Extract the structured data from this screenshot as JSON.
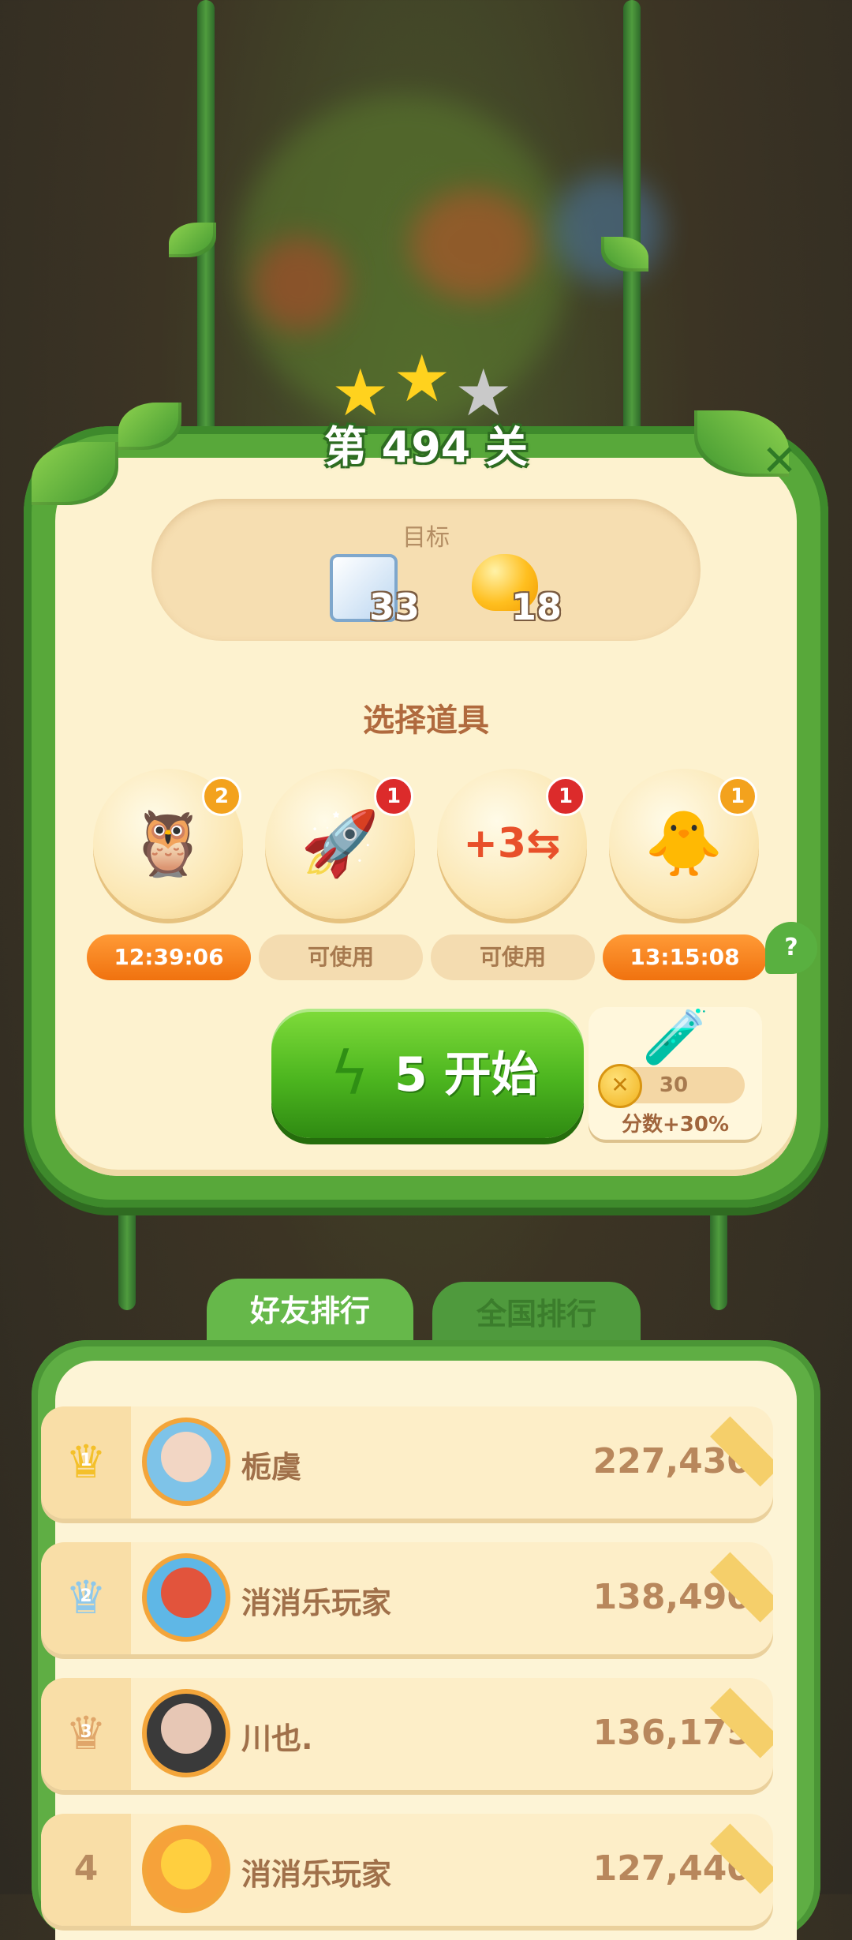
{
  "level": {
    "title": "第 494 关",
    "stars": [
      "gold",
      "gold",
      "gray"
    ]
  },
  "goal": {
    "label": "目标",
    "items": [
      {
        "icon": "ice-block-icon",
        "count": "33"
      },
      {
        "icon": "jelly-icon",
        "count": "18"
      }
    ]
  },
  "tools": {
    "title": "选择道具",
    "items": [
      {
        "icon": "rainbow-bird-icon",
        "badge": "2",
        "status": "12:39:06",
        "state": "timer"
      },
      {
        "icon": "rocket-icon",
        "badge": "1",
        "status": "可使用",
        "state": "usable"
      },
      {
        "icon": "plus-three-moves-icon",
        "badge": "1",
        "status": "可使用",
        "state": "usable"
      },
      {
        "icon": "animal-swap-icon",
        "badge": "1",
        "status": "13:15:08",
        "state": "timer"
      }
    ],
    "help": "?"
  },
  "start": {
    "cost": "5",
    "label": "开始"
  },
  "booster": {
    "coins": "30",
    "label": "分数+30%"
  },
  "leaderboard": {
    "tabs": [
      "好友排行",
      "全国排行"
    ],
    "rows": [
      {
        "rank": "1",
        "name": "栀虞",
        "score": "227,430",
        "crown": "gold"
      },
      {
        "rank": "2",
        "name": "消消乐玩家",
        "score": "138,490",
        "crown": "silver"
      },
      {
        "rank": "3",
        "name": "川也.",
        "score": "136,175",
        "crown": "bronze"
      },
      {
        "rank": "4",
        "name": "消消乐玩家",
        "score": "127,440",
        "crown": ""
      }
    ]
  },
  "colors": {
    "panel_green": "#58a83a",
    "panel_cream": "#fdf2cf",
    "start_green": "#4cb51f",
    "timer_orange": "#f0720f"
  }
}
